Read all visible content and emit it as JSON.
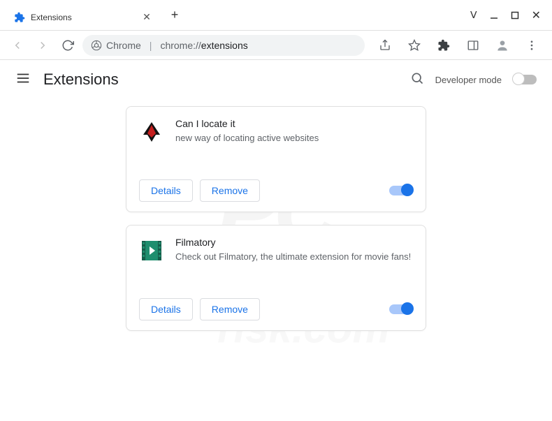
{
  "window": {
    "tab": {
      "title": "Extensions",
      "favicon": "puzzle-piece-icon"
    }
  },
  "toolbar": {
    "chrome_chip": "Chrome",
    "url_path": "chrome://",
    "url_page": "extensions"
  },
  "header": {
    "title": "Extensions",
    "dev_mode_label": "Developer mode",
    "dev_mode_on": false
  },
  "extensions": [
    {
      "name": "Can I locate it",
      "description": "new way of locating active websites",
      "details_label": "Details",
      "remove_label": "Remove",
      "enabled": true,
      "icon": "eagle-icon"
    },
    {
      "name": "Filmatory",
      "description": "Check out Filmatory, the ultimate extension for movie fans!",
      "details_label": "Details",
      "remove_label": "Remove",
      "enabled": true,
      "icon": "film-icon"
    }
  ],
  "watermark": {
    "big": "PC",
    "small": "risk.com"
  }
}
